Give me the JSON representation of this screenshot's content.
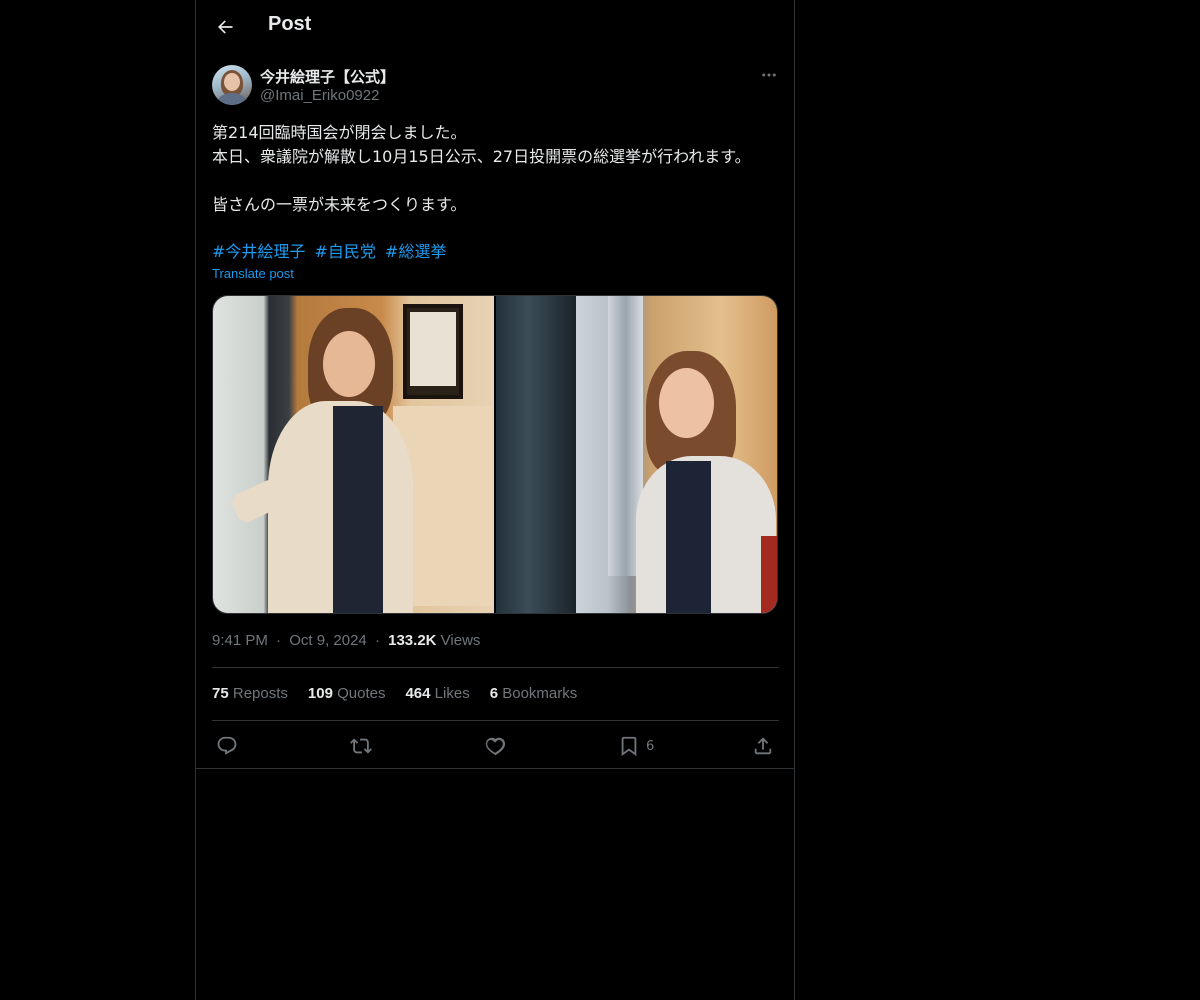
{
  "header": {
    "title": "Post"
  },
  "author": {
    "name": "今井絵理子【公式】",
    "handle": "@Imai_Eriko0922"
  },
  "post": {
    "lines": [
      "第214回臨時国会が閉会しました。",
      "本日、衆議院が解散し10月15日公示、27日投開票の総選挙が行われます。",
      "",
      "皆さんの一票が未来をつくります。"
    ],
    "hashtags": [
      "#今井絵理子",
      "#自民党",
      "#総選挙"
    ],
    "translate_label": "Translate post"
  },
  "meta": {
    "time": "9:41 PM",
    "date": "Oct 9, 2024",
    "views_count": "133.2K",
    "views_label": "Views",
    "separator": "·"
  },
  "engagement": {
    "reposts_count": "75",
    "reposts_label": "Reposts",
    "quotes_count": "109",
    "quotes_label": "Quotes",
    "likes_count": "464",
    "likes_label": "Likes",
    "bookmarks_count": "6",
    "bookmarks_label": "Bookmarks"
  },
  "actions": {
    "reply": "reply-icon",
    "repost": "repost-icon",
    "like": "heart-icon",
    "bookmark": "bookmark-icon",
    "bookmark_count": "6",
    "share": "share-icon"
  },
  "colors": {
    "accent": "#1d9bf0",
    "muted": "#71767b",
    "text": "#e7e9ea",
    "border": "#2f3336",
    "background": "#000000"
  }
}
